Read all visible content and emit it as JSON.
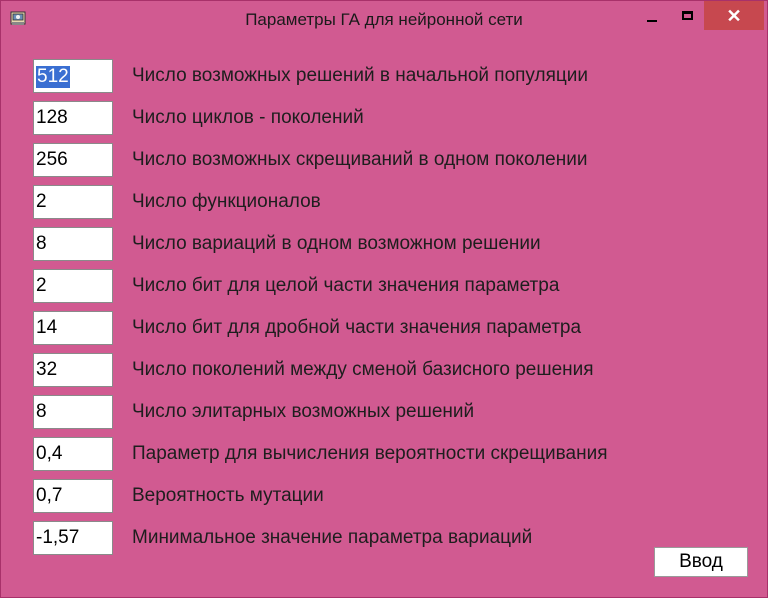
{
  "window": {
    "title": "Параметры ГА для нейронной сети"
  },
  "colors": {
    "background": "#d15a91",
    "selection": "#3a6fd2",
    "close_button": "#c7484f"
  },
  "params": [
    {
      "value": "512",
      "label": "Число возможных решений в начальной популяции",
      "selected": true
    },
    {
      "value": "128",
      "label": "Число циклов - поколений"
    },
    {
      "value": "256",
      "label": "Число возможных скрещиваний в одном поколении"
    },
    {
      "value": "2",
      "label": "Число функционалов"
    },
    {
      "value": "8",
      "label": "Число вариаций в одном возможном решении"
    },
    {
      "value": "2",
      "label": "Число бит для целой части значения параметра"
    },
    {
      "value": "14",
      "label": "Число бит для дробной части значения параметра"
    },
    {
      "value": "32",
      "label": "Число поколений между  сменой базисного решения"
    },
    {
      "value": "8",
      "label": "Число элитарных возможных решений"
    },
    {
      "value": "0,4",
      "label": "Параметр для вычисления вероятности скрещивания"
    },
    {
      "value": "0,7",
      "label": "Вероятность мутации"
    },
    {
      "value": "-1,57",
      "label": "Минимальное значение параметра вариаций"
    }
  ],
  "buttons": {
    "ok_label": "Ввод"
  }
}
